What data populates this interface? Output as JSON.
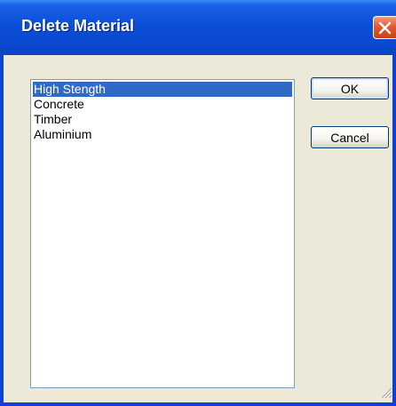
{
  "window": {
    "title": "Delete Material",
    "close_icon": "close-icon"
  },
  "materials": {
    "items": [
      {
        "label": "High Stength",
        "selected": true
      },
      {
        "label": "Concrete",
        "selected": false
      },
      {
        "label": "Timber",
        "selected": false
      },
      {
        "label": "Aluminium",
        "selected": false
      }
    ]
  },
  "buttons": {
    "ok_label": "OK",
    "cancel_label": "Cancel"
  },
  "colors": {
    "titlebar": "#0A48D0",
    "dialog_bg": "#ECE9D8",
    "selection": "#316AC5",
    "close_button": "#E3592F"
  }
}
